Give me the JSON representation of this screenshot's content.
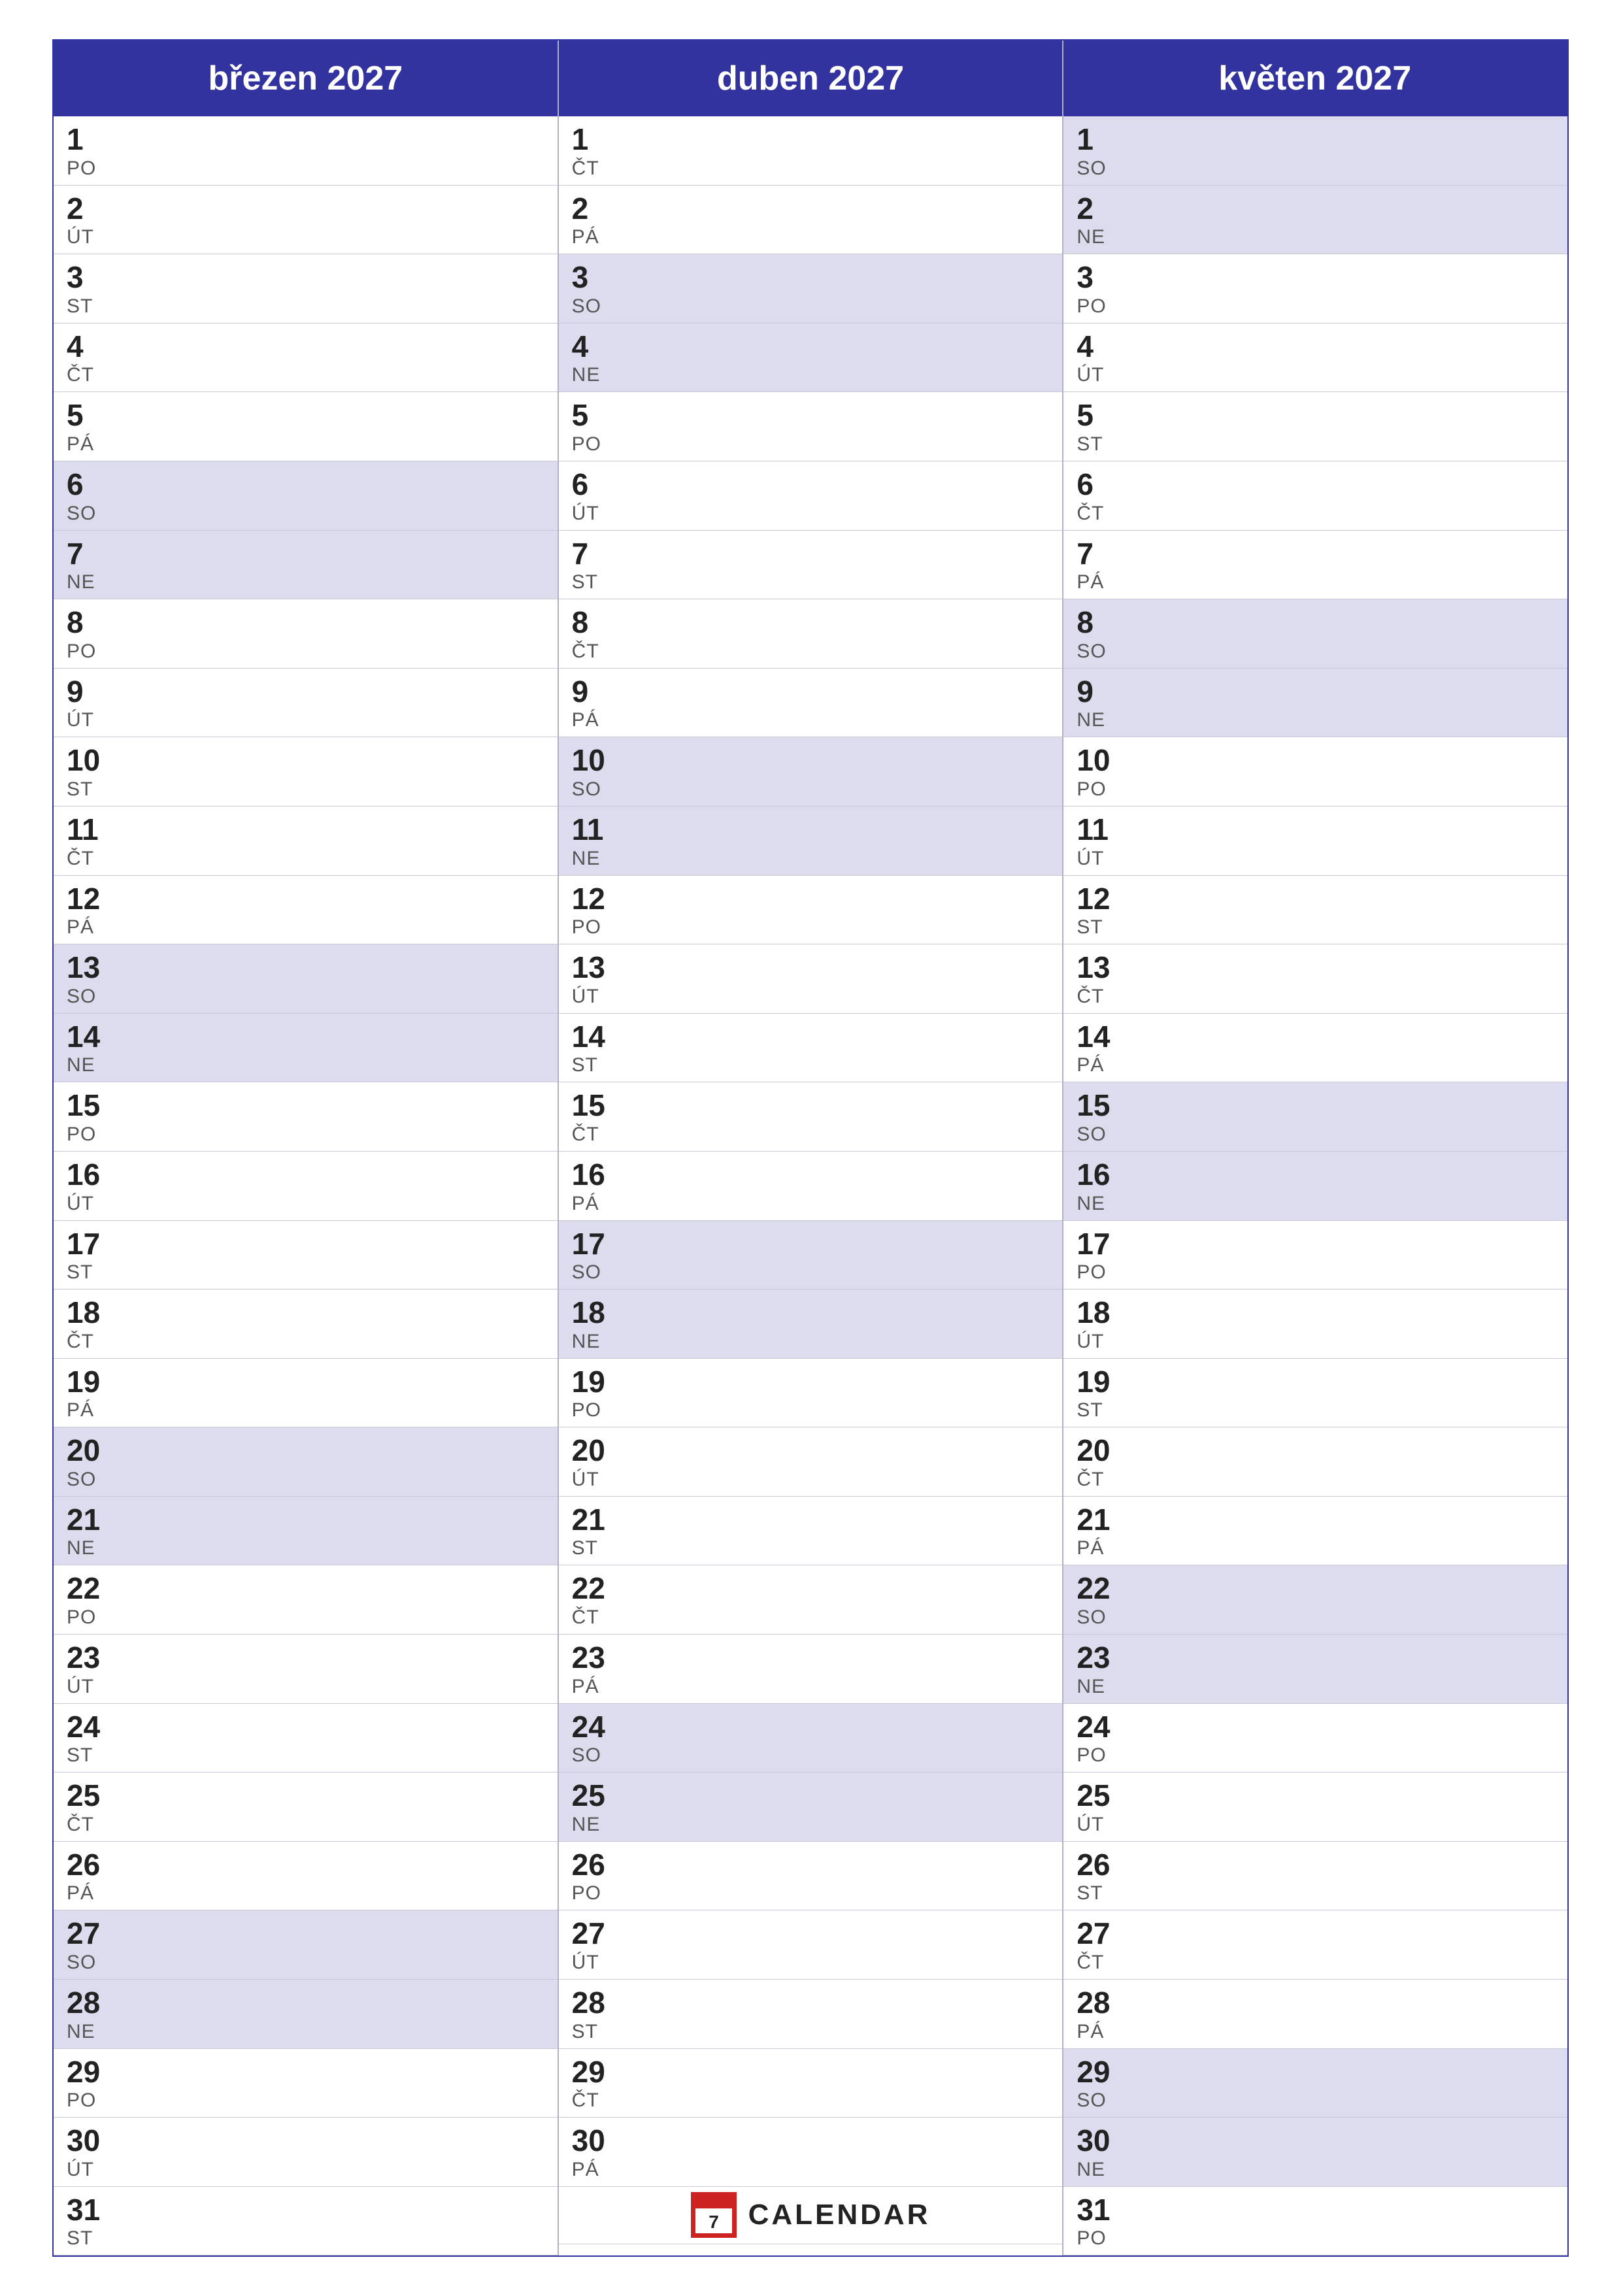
{
  "months": [
    {
      "name": "březen 2027",
      "days": [
        {
          "num": "1",
          "day": "PO",
          "weekend": false
        },
        {
          "num": "2",
          "day": "ÚT",
          "weekend": false
        },
        {
          "num": "3",
          "day": "ST",
          "weekend": false
        },
        {
          "num": "4",
          "day": "ČT",
          "weekend": false
        },
        {
          "num": "5",
          "day": "PÁ",
          "weekend": false
        },
        {
          "num": "6",
          "day": "SO",
          "weekend": true
        },
        {
          "num": "7",
          "day": "NE",
          "weekend": true
        },
        {
          "num": "8",
          "day": "PO",
          "weekend": false
        },
        {
          "num": "9",
          "day": "ÚT",
          "weekend": false
        },
        {
          "num": "10",
          "day": "ST",
          "weekend": false
        },
        {
          "num": "11",
          "day": "ČT",
          "weekend": false
        },
        {
          "num": "12",
          "day": "PÁ",
          "weekend": false
        },
        {
          "num": "13",
          "day": "SO",
          "weekend": true
        },
        {
          "num": "14",
          "day": "NE",
          "weekend": true
        },
        {
          "num": "15",
          "day": "PO",
          "weekend": false
        },
        {
          "num": "16",
          "day": "ÚT",
          "weekend": false
        },
        {
          "num": "17",
          "day": "ST",
          "weekend": false
        },
        {
          "num": "18",
          "day": "ČT",
          "weekend": false
        },
        {
          "num": "19",
          "day": "PÁ",
          "weekend": false
        },
        {
          "num": "20",
          "day": "SO",
          "weekend": true
        },
        {
          "num": "21",
          "day": "NE",
          "weekend": true
        },
        {
          "num": "22",
          "day": "PO",
          "weekend": false
        },
        {
          "num": "23",
          "day": "ÚT",
          "weekend": false
        },
        {
          "num": "24",
          "day": "ST",
          "weekend": false
        },
        {
          "num": "25",
          "day": "ČT",
          "weekend": false
        },
        {
          "num": "26",
          "day": "PÁ",
          "weekend": false
        },
        {
          "num": "27",
          "day": "SO",
          "weekend": true
        },
        {
          "num": "28",
          "day": "NE",
          "weekend": true
        },
        {
          "num": "29",
          "day": "PO",
          "weekend": false
        },
        {
          "num": "30",
          "day": "ÚT",
          "weekend": false
        },
        {
          "num": "31",
          "day": "ST",
          "weekend": false
        }
      ]
    },
    {
      "name": "duben 2027",
      "days": [
        {
          "num": "1",
          "day": "ČT",
          "weekend": false
        },
        {
          "num": "2",
          "day": "PÁ",
          "weekend": false
        },
        {
          "num": "3",
          "day": "SO",
          "weekend": true
        },
        {
          "num": "4",
          "day": "NE",
          "weekend": true
        },
        {
          "num": "5",
          "day": "PO",
          "weekend": false
        },
        {
          "num": "6",
          "day": "ÚT",
          "weekend": false
        },
        {
          "num": "7",
          "day": "ST",
          "weekend": false
        },
        {
          "num": "8",
          "day": "ČT",
          "weekend": false
        },
        {
          "num": "9",
          "day": "PÁ",
          "weekend": false
        },
        {
          "num": "10",
          "day": "SO",
          "weekend": true
        },
        {
          "num": "11",
          "day": "NE",
          "weekend": true
        },
        {
          "num": "12",
          "day": "PO",
          "weekend": false
        },
        {
          "num": "13",
          "day": "ÚT",
          "weekend": false
        },
        {
          "num": "14",
          "day": "ST",
          "weekend": false
        },
        {
          "num": "15",
          "day": "ČT",
          "weekend": false
        },
        {
          "num": "16",
          "day": "PÁ",
          "weekend": false
        },
        {
          "num": "17",
          "day": "SO",
          "weekend": true
        },
        {
          "num": "18",
          "day": "NE",
          "weekend": true
        },
        {
          "num": "19",
          "day": "PO",
          "weekend": false
        },
        {
          "num": "20",
          "day": "ÚT",
          "weekend": false
        },
        {
          "num": "21",
          "day": "ST",
          "weekend": false
        },
        {
          "num": "22",
          "day": "ČT",
          "weekend": false
        },
        {
          "num": "23",
          "day": "PÁ",
          "weekend": false
        },
        {
          "num": "24",
          "day": "SO",
          "weekend": true
        },
        {
          "num": "25",
          "day": "NE",
          "weekend": true
        },
        {
          "num": "26",
          "day": "PO",
          "weekend": false
        },
        {
          "num": "27",
          "day": "ÚT",
          "weekend": false
        },
        {
          "num": "28",
          "day": "ST",
          "weekend": false
        },
        {
          "num": "29",
          "day": "ČT",
          "weekend": false
        },
        {
          "num": "30",
          "day": "PÁ",
          "weekend": false
        },
        {
          "num": "",
          "day": "",
          "weekend": false,
          "logo": true
        }
      ]
    },
    {
      "name": "květen 2027",
      "days": [
        {
          "num": "1",
          "day": "SO",
          "weekend": true
        },
        {
          "num": "2",
          "day": "NE",
          "weekend": true
        },
        {
          "num": "3",
          "day": "PO",
          "weekend": false
        },
        {
          "num": "4",
          "day": "ÚT",
          "weekend": false
        },
        {
          "num": "5",
          "day": "ST",
          "weekend": false
        },
        {
          "num": "6",
          "day": "ČT",
          "weekend": false
        },
        {
          "num": "7",
          "day": "PÁ",
          "weekend": false
        },
        {
          "num": "8",
          "day": "SO",
          "weekend": true
        },
        {
          "num": "9",
          "day": "NE",
          "weekend": true
        },
        {
          "num": "10",
          "day": "PO",
          "weekend": false
        },
        {
          "num": "11",
          "day": "ÚT",
          "weekend": false
        },
        {
          "num": "12",
          "day": "ST",
          "weekend": false
        },
        {
          "num": "13",
          "day": "ČT",
          "weekend": false
        },
        {
          "num": "14",
          "day": "PÁ",
          "weekend": false
        },
        {
          "num": "15",
          "day": "SO",
          "weekend": true
        },
        {
          "num": "16",
          "day": "NE",
          "weekend": true
        },
        {
          "num": "17",
          "day": "PO",
          "weekend": false
        },
        {
          "num": "18",
          "day": "ÚT",
          "weekend": false
        },
        {
          "num": "19",
          "day": "ST",
          "weekend": false
        },
        {
          "num": "20",
          "day": "ČT",
          "weekend": false
        },
        {
          "num": "21",
          "day": "PÁ",
          "weekend": false
        },
        {
          "num": "22",
          "day": "SO",
          "weekend": true
        },
        {
          "num": "23",
          "day": "NE",
          "weekend": true
        },
        {
          "num": "24",
          "day": "PO",
          "weekend": false
        },
        {
          "num": "25",
          "day": "ÚT",
          "weekend": false
        },
        {
          "num": "26",
          "day": "ST",
          "weekend": false
        },
        {
          "num": "27",
          "day": "ČT",
          "weekend": false
        },
        {
          "num": "28",
          "day": "PÁ",
          "weekend": false
        },
        {
          "num": "29",
          "day": "SO",
          "weekend": true
        },
        {
          "num": "30",
          "day": "NE",
          "weekend": true
        },
        {
          "num": "31",
          "day": "PO",
          "weekend": false
        }
      ]
    }
  ],
  "logo": {
    "text": "CALENDAR"
  }
}
